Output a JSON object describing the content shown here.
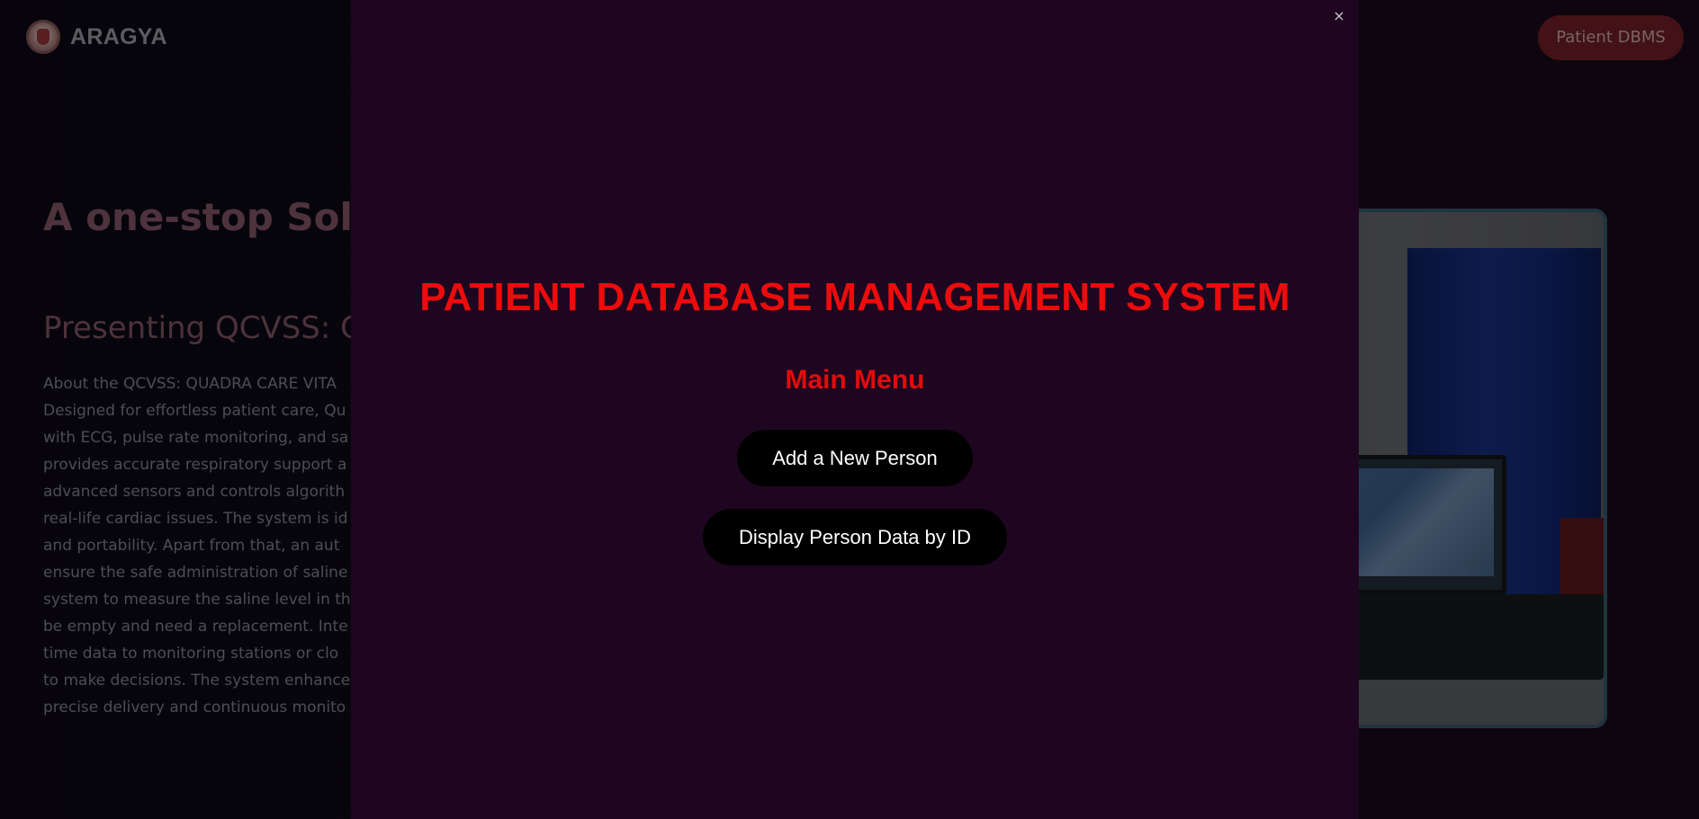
{
  "navbar": {
    "brand": "ARAGYA",
    "logo_icon": "aragya-logo-icon",
    "cta_label": "Patient DBMS"
  },
  "hero": {
    "title": "A one-stop Solu Needs",
    "subtitle": "Presenting QCVSS: C",
    "body_lines": [
      "About the QCVSS: QUADRA CARE VITA",
      "Designed for effortless patient care, Qu",
      "with ECG, pulse rate monitoring, and sa",
      "provides accurate respiratory support a",
      "advanced sensors and controls algorith",
      "real-life cardiac issues. The system is id",
      "and portability. Apart from that, an aut",
      "ensure the safe administration of saline",
      "system to measure the saline level in th",
      "be empty and need a replacement. Inte",
      "time data to monitoring stations or clo",
      "to make decisions. The system enhance",
      "precise delivery and continuous monito"
    ],
    "image_alt": "device-photo"
  },
  "modal": {
    "close_label": "×",
    "title": "PATIENT DATABASE MANAGEMENT SYSTEM",
    "subtitle": "Main Menu",
    "buttons": {
      "add": "Add a New Person",
      "display": "Display Person Data by ID"
    }
  },
  "colors": {
    "modal_bg": "#1f0620",
    "title_red": "#ec0c0c",
    "button_bg": "#000000",
    "nav_cta_bg": "#5e1a1f"
  }
}
